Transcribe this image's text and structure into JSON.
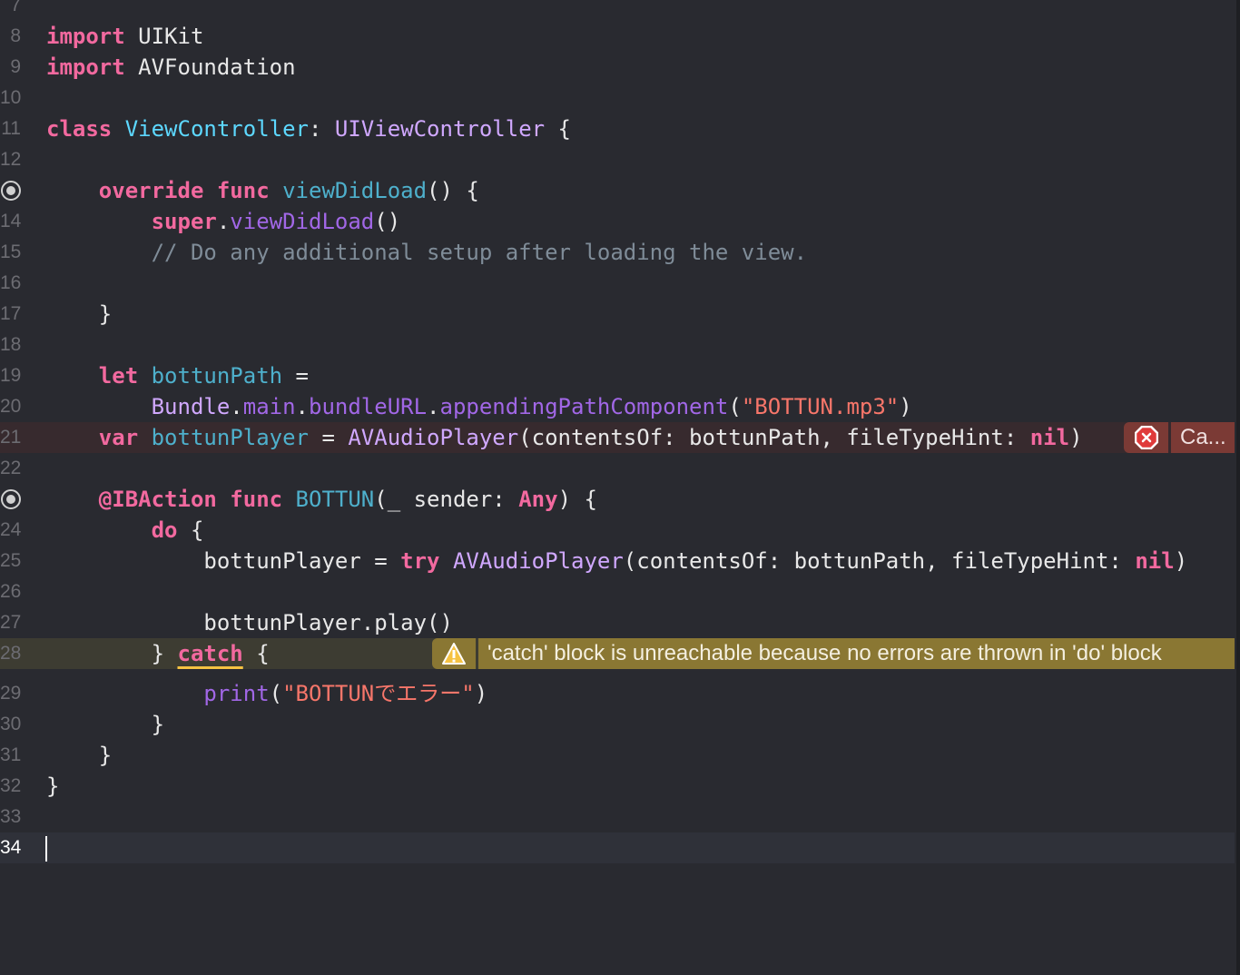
{
  "colors": {
    "background": "#292a30",
    "keyword": "#f2699f",
    "declaration": "#4eb0cc",
    "type": "#d0a8ff",
    "member": "#a167e6",
    "comment": "#7f8c98",
    "string": "#f7766a",
    "error_badge": "#7b3a35",
    "warning_badge": "#8a7733"
  },
  "lines": [
    {
      "n": "7",
      "tokens": []
    },
    {
      "n": "8",
      "tokens": [
        {
          "t": "import",
          "c": "kw"
        },
        {
          "t": " UIKit",
          "c": "plain"
        }
      ]
    },
    {
      "n": "9",
      "tokens": [
        {
          "t": "import",
          "c": "kw"
        },
        {
          "t": " AVFoundation",
          "c": "plain"
        }
      ]
    },
    {
      "n": "10",
      "tokens": []
    },
    {
      "n": "11",
      "tokens": [
        {
          "t": "class",
          "c": "kw"
        },
        {
          "t": " ",
          "c": "plain"
        },
        {
          "t": "ViewController",
          "c": "cls"
        },
        {
          "t": ": ",
          "c": "plain"
        },
        {
          "t": "UIViewController",
          "c": "type"
        },
        {
          "t": " {",
          "c": "plain"
        }
      ]
    },
    {
      "n": "12",
      "tokens": []
    },
    {
      "n": "13",
      "marker": "breakpoint-icon",
      "tokens": [
        {
          "t": "    ",
          "c": "plain"
        },
        {
          "t": "override",
          "c": "kw"
        },
        {
          "t": " ",
          "c": "plain"
        },
        {
          "t": "func",
          "c": "kw"
        },
        {
          "t": " ",
          "c": "plain"
        },
        {
          "t": "viewDidLoad",
          "c": "decl"
        },
        {
          "t": "() {",
          "c": "plain"
        }
      ]
    },
    {
      "n": "14",
      "tokens": [
        {
          "t": "        ",
          "c": "plain"
        },
        {
          "t": "super",
          "c": "kw"
        },
        {
          "t": ".",
          "c": "plain"
        },
        {
          "t": "viewDidLoad",
          "c": "mem"
        },
        {
          "t": "()",
          "c": "plain"
        }
      ]
    },
    {
      "n": "15",
      "tokens": [
        {
          "t": "        // Do any additional setup after loading the view.",
          "c": "cm"
        }
      ]
    },
    {
      "n": "16",
      "tokens": []
    },
    {
      "n": "17",
      "tokens": [
        {
          "t": "    }",
          "c": "plain"
        }
      ]
    },
    {
      "n": "18",
      "tokens": []
    },
    {
      "n": "19",
      "tokens": [
        {
          "t": "    ",
          "c": "plain"
        },
        {
          "t": "let",
          "c": "kw"
        },
        {
          "t": " ",
          "c": "plain"
        },
        {
          "t": "bottunPath",
          "c": "decl"
        },
        {
          "t": " =",
          "c": "plain"
        }
      ]
    },
    {
      "n": "20",
      "tokens": [
        {
          "t": "        ",
          "c": "plain"
        },
        {
          "t": "Bundle",
          "c": "type"
        },
        {
          "t": ".",
          "c": "plain"
        },
        {
          "t": "main",
          "c": "mem"
        },
        {
          "t": ".",
          "c": "plain"
        },
        {
          "t": "bundleURL",
          "c": "mem"
        },
        {
          "t": ".",
          "c": "plain"
        },
        {
          "t": "appendingPathComponent",
          "c": "mem"
        },
        {
          "t": "(",
          "c": "plain"
        },
        {
          "t": "\"BOTTUN.mp3\"",
          "c": "str"
        },
        {
          "t": ")",
          "c": "plain"
        }
      ]
    },
    {
      "n": "21",
      "state": "error",
      "tokens": [
        {
          "t": "    ",
          "c": "plain"
        },
        {
          "t": "var",
          "c": "kw"
        },
        {
          "t": " ",
          "c": "plain"
        },
        {
          "t": "bottunPlayer",
          "c": "decl"
        },
        {
          "t": " = ",
          "c": "plain"
        },
        {
          "t": "AVAudioPlayer",
          "c": "type"
        },
        {
          "t": "(contentsOf: bottunPath, fileTypeHint: ",
          "c": "plain"
        },
        {
          "t": "nil",
          "c": "kw"
        },
        {
          "t": ")",
          "c": "plain"
        }
      ]
    },
    {
      "n": "22",
      "tokens": []
    },
    {
      "n": "23",
      "marker": "breakpoint-icon",
      "tokens": [
        {
          "t": "    ",
          "c": "plain"
        },
        {
          "t": "@IBAction",
          "c": "kw"
        },
        {
          "t": " ",
          "c": "plain"
        },
        {
          "t": "func",
          "c": "kw"
        },
        {
          "t": " ",
          "c": "plain"
        },
        {
          "t": "BOTTUN",
          "c": "decl"
        },
        {
          "t": "(_ sender: ",
          "c": "plain"
        },
        {
          "t": "Any",
          "c": "kw"
        },
        {
          "t": ") {",
          "c": "plain"
        }
      ]
    },
    {
      "n": "24",
      "tokens": [
        {
          "t": "        ",
          "c": "plain"
        },
        {
          "t": "do",
          "c": "kw"
        },
        {
          "t": " {",
          "c": "plain"
        }
      ]
    },
    {
      "n": "25",
      "tokens": [
        {
          "t": "            bottunPlayer = ",
          "c": "plain"
        },
        {
          "t": "try",
          "c": "kw"
        },
        {
          "t": " ",
          "c": "plain"
        },
        {
          "t": "AVAudioPlayer",
          "c": "type"
        },
        {
          "t": "(contentsOf: bottunPath, fileTypeHint: ",
          "c": "plain"
        },
        {
          "t": "nil",
          "c": "kw"
        },
        {
          "t": ")",
          "c": "plain"
        }
      ]
    },
    {
      "n": "26",
      "tokens": []
    },
    {
      "n": "27",
      "tokens": [
        {
          "t": "            bottunPlayer.play()",
          "c": "plain"
        }
      ]
    },
    {
      "n": "28",
      "state": "warning",
      "tokens": [
        {
          "t": "        } ",
          "c": "plain"
        },
        {
          "t": "catch",
          "c": "kw warnword"
        },
        {
          "t": " {",
          "c": "plain"
        }
      ]
    },
    {
      "n": "29",
      "tall": true,
      "tokens": [
        {
          "t": "            ",
          "c": "plain"
        },
        {
          "t": "print",
          "c": "mem"
        },
        {
          "t": "(",
          "c": "plain"
        },
        {
          "t": "\"BOTTUNでエラー\"",
          "c": "str"
        },
        {
          "t": ")",
          "c": "plain"
        }
      ]
    },
    {
      "n": "30",
      "tokens": [
        {
          "t": "        }",
          "c": "plain"
        }
      ]
    },
    {
      "n": "31",
      "tokens": [
        {
          "t": "    }",
          "c": "plain"
        }
      ]
    },
    {
      "n": "32",
      "tokens": [
        {
          "t": "}",
          "c": "plain"
        }
      ]
    },
    {
      "n": "33",
      "tokens": []
    },
    {
      "n": "34",
      "state": "current",
      "tokens": []
    }
  ],
  "error_badge": {
    "icon": "error-x-icon",
    "text": "Ca..."
  },
  "warning_badge": {
    "icon": "warning-triangle-icon",
    "text": "'catch' block is unreachable because no errors are thrown in 'do' block"
  }
}
